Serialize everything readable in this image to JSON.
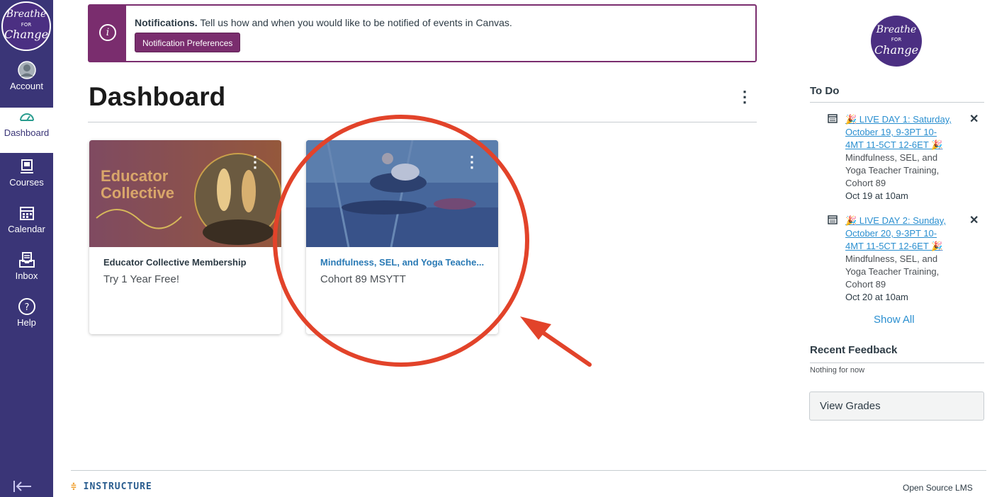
{
  "nav": {
    "logo_text": [
      "Breathe",
      "FOR",
      "Change"
    ],
    "items": [
      {
        "label": "Account",
        "icon": "account-icon"
      },
      {
        "label": "Dashboard",
        "icon": "dashboard-icon"
      },
      {
        "label": "Courses",
        "icon": "courses-icon"
      },
      {
        "label": "Calendar",
        "icon": "calendar-icon"
      },
      {
        "label": "Inbox",
        "icon": "inbox-icon"
      },
      {
        "label": "Help",
        "icon": "help-icon"
      }
    ],
    "collapse_icon": "collapse-nav-icon"
  },
  "notification": {
    "title": "Notifications.",
    "message": "Tell us how and when you would like to be notified of events in Canvas.",
    "button_label": "Notification Preferences",
    "accent": "#7a2d6e"
  },
  "dashboard": {
    "title": "Dashboard",
    "menu_glyph": "⋮"
  },
  "cards": [
    {
      "hero_text": [
        "Educator",
        "Collective"
      ],
      "title": "Educator Collective Membership",
      "subtitle": "Try 1 Year Free!",
      "menu_glyph": "⋮"
    },
    {
      "title": "Mindfulness, SEL, and Yoga Teache...",
      "subtitle": "Cohort 89 MSYTT",
      "menu_glyph": "⋮"
    }
  ],
  "todo": {
    "heading": "To Do",
    "items": [
      {
        "link_lines": [
          "🎉 LIVE DAY 1: Saturday,",
          "October 19, 9-3PT 10-",
          "4MT 11-5CT 12-6ET 🎉"
        ],
        "context_lines": [
          "Mindfulness, SEL, and",
          "Yoga Teacher Training,",
          "Cohort 89"
        ],
        "when": "Oct 19 at 10am",
        "dismiss": "✕"
      },
      {
        "link_lines": [
          "🎉 LIVE DAY 2: Sunday,",
          "October 20, 9-3PT 10-",
          "4MT 11-5CT 12-6ET 🎉"
        ],
        "context_lines": [
          "Mindfulness, SEL, and",
          "Yoga Teacher Training,",
          "Cohort 89"
        ],
        "when": "Oct 20 at 10am",
        "dismiss": "✕"
      }
    ],
    "show_all": "Show All"
  },
  "feedback": {
    "heading": "Recent Feedback",
    "empty": "Nothing for now"
  },
  "view_grades": "View Grades",
  "footer": {
    "brand": "INSTRUCTURE",
    "right": "Open Source LMS"
  },
  "colors": {
    "nav_bg": "#3a3577",
    "link": "#2a8fd0",
    "annotation": "#e2432a"
  }
}
